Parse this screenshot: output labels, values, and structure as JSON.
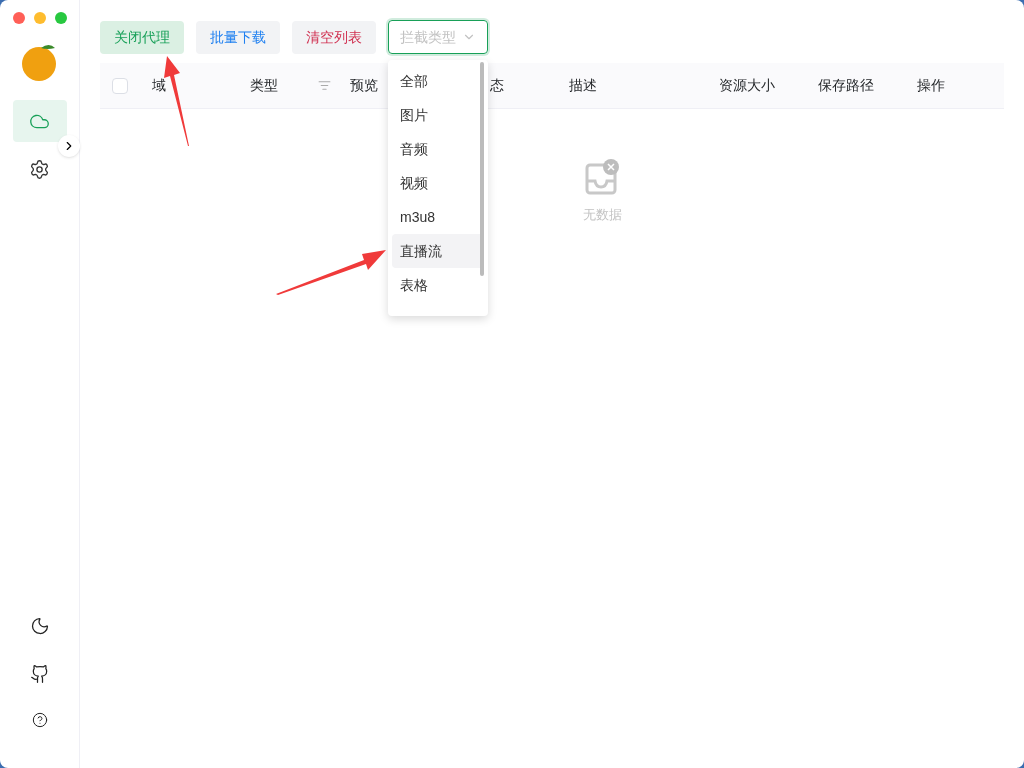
{
  "toolbar": {
    "buttons": [
      {
        "label": "关闭代理",
        "kind": "success"
      },
      {
        "label": "批量下载",
        "kind": "primary"
      },
      {
        "label": "清空列表",
        "kind": "danger"
      }
    ],
    "type_select": {
      "placeholder": "拦截类型",
      "expanded": true
    }
  },
  "sidebar": {
    "items": [
      {
        "selected": true
      },
      {
        "selected": false
      }
    ]
  },
  "table": {
    "select_all_checked": false,
    "columns": [
      {
        "label": "域"
      },
      {
        "label": "类型",
        "filter": true
      },
      {
        "label": "预览"
      },
      {
        "label": "态"
      },
      {
        "label": "描述"
      },
      {
        "label": "资源大小"
      },
      {
        "label": "保存路径"
      },
      {
        "label": "操作"
      }
    ],
    "empty_text": "无数据"
  },
  "dropdown": {
    "options": [
      {
        "label": "全部",
        "selected": false
      },
      {
        "label": "图片",
        "selected": false
      },
      {
        "label": "音频",
        "selected": false
      },
      {
        "label": "视频",
        "selected": false
      },
      {
        "label": "m3u8",
        "selected": false
      },
      {
        "label": "直播流",
        "selected": true
      },
      {
        "label": "表格",
        "selected": false
      }
    ]
  }
}
